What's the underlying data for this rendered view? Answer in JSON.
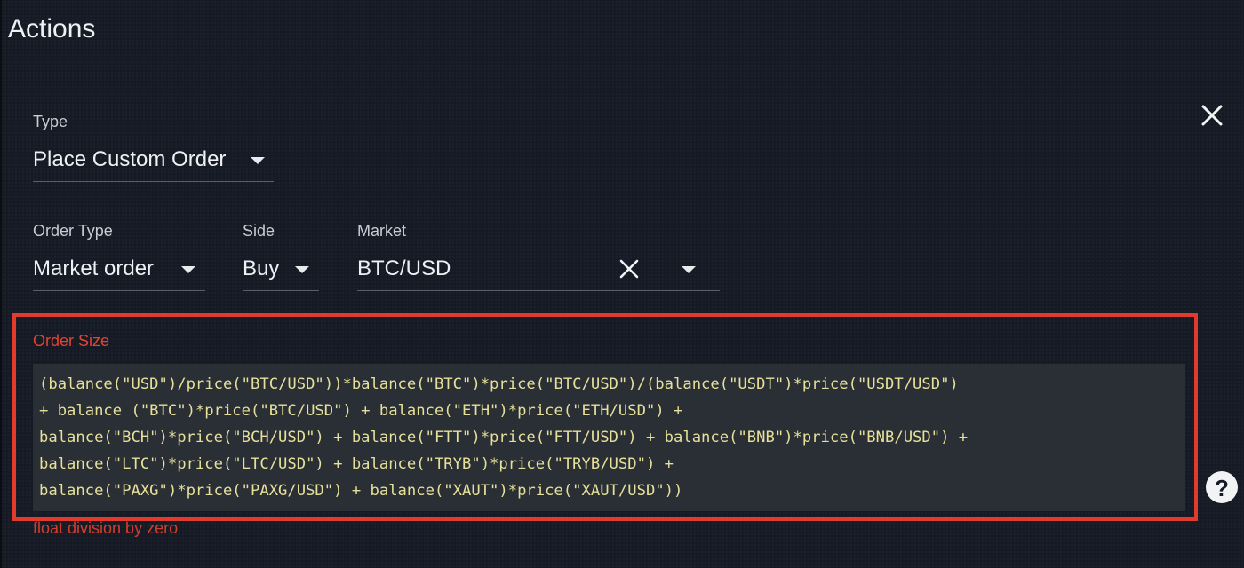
{
  "page": {
    "title": "Actions"
  },
  "form": {
    "type": {
      "label": "Type",
      "value": "Place Custom Order"
    },
    "order_type": {
      "label": "Order Type",
      "value": "Market order"
    },
    "side": {
      "label": "Side",
      "value": "Buy"
    },
    "market": {
      "label": "Market",
      "value": "BTC/USD"
    },
    "order_size": {
      "label": "Order Size",
      "lines": [
        "(balance(\"USD\")/price(\"BTC/USD\"))*balance(\"BTC\")*price(\"BTC/USD\")/(balance(\"USDT\")*price(\"USDT/USD\")",
        "+ balance (\"BTC\")*price(\"BTC/USD\") + balance(\"ETH\")*price(\"ETH/USD\") +",
        "balance(\"BCH\")*price(\"BCH/USD\") + balance(\"FTT\")*price(\"FTT/USD\") + balance(\"BNB\")*price(\"BNB/USD\") +",
        "balance(\"LTC\")*price(\"LTC/USD\") + balance(\"TRYB\")*price(\"TRYB/USD\") +",
        "balance(\"PAXG\")*price(\"PAXG/USD\") + balance(\"XAUT\")*price(\"XAUT/USD\"))"
      ],
      "error": "float division by zero"
    }
  },
  "help": {
    "symbol": "?"
  },
  "colors": {
    "background": "#161a24",
    "error": "#e23b2e",
    "code_background": "#2a2f36",
    "code_text": "#e6e09a"
  },
  "icons": {
    "close": "close-icon",
    "clear": "clear-icon",
    "dropdown": "chevron-down-icon",
    "help": "help-icon"
  }
}
